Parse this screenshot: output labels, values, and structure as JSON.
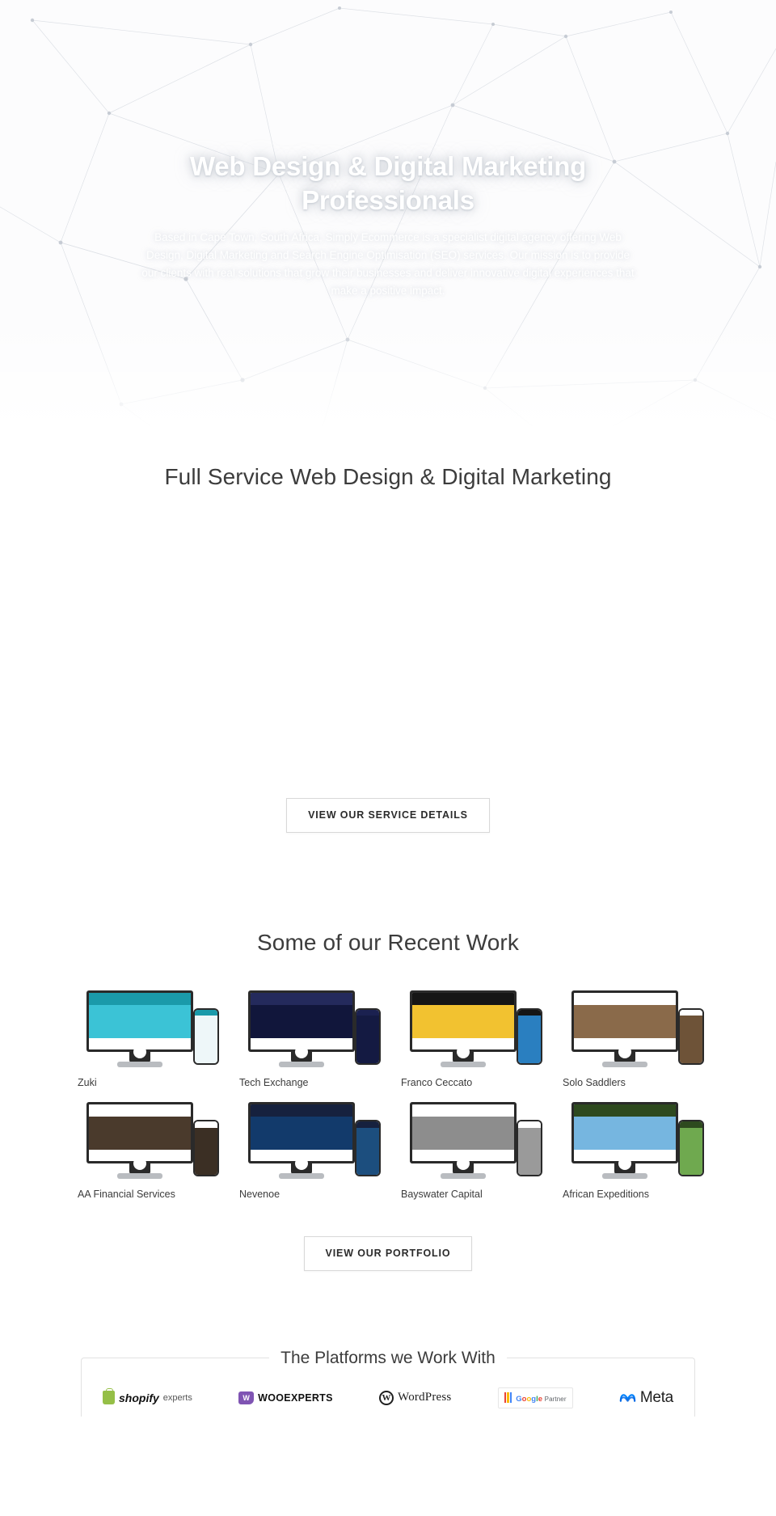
{
  "hero": {
    "title": "Web Design & Digital Marketing Professionals",
    "paragraph": "Based in Cape Town, South Africa, Simply Ecommerce is a specialist digital agency offering Web Design, Digital Marketing and Search Engine Optimisation (SEO) services. Our mission is to provide our clients with real solutions that grow their businesses and deliver innovative digital experiences that make a positive impact."
  },
  "services": {
    "title": "Full Service Web Design & Digital Marketing",
    "button_label": "VIEW OUR SERVICE DETAILS",
    "cards": [
      {
        "icon": "monitor-icon",
        "name": "",
        "desc": ""
      },
      {
        "icon": "cart-icon",
        "name": "",
        "desc": ""
      },
      {
        "icon": "chart-icon",
        "name": "",
        "desc": ""
      },
      {
        "icon": "search-icon",
        "name": "",
        "desc": ""
      },
      {
        "icon": "megaphone-icon",
        "name": "",
        "desc": ""
      },
      {
        "icon": "gear-icon",
        "name": "",
        "desc": ""
      }
    ]
  },
  "portfolio": {
    "title": "Some of our Recent Work",
    "button_label": "VIEW OUR PORTFOLIO",
    "items": [
      {
        "label": "Zuki",
        "bar": "#1a9aaa",
        "hero": "#3bc3d6",
        "accent": "#0e7d8c",
        "phone_bar": "#1a9aaa",
        "phone_hero": "#eef7f9"
      },
      {
        "label": "Tech Exchange",
        "bar": "#242a5c",
        "hero": "#11163b",
        "accent": "#2ec4b6",
        "phone_bar": "#1b2150",
        "phone_hero": "#141a42"
      },
      {
        "label": "Franco Ceccato",
        "bar": "#151515",
        "hero": "#f2c230",
        "accent": "#1d7fc4",
        "phone_bar": "#151515",
        "phone_hero": "#2a7fc0"
      },
      {
        "label": "Solo Saddlers",
        "bar": "#ffffff",
        "hero": "#8a6a4a",
        "accent": "#c0392b",
        "phone_bar": "#ffffff",
        "phone_hero": "#6e5338"
      },
      {
        "label": "AA Financial Services",
        "bar": "#ffffff",
        "hero": "#4a3a2c",
        "accent": "#e8a33d",
        "phone_bar": "#ffffff",
        "phone_hero": "#3b2f24"
      },
      {
        "label": "Nevenoe",
        "bar": "#16213e",
        "hero": "#123a6b",
        "accent": "#3ab0e0",
        "phone_bar": "#16213e",
        "phone_hero": "#1c4e7e"
      },
      {
        "label": "Bayswater Capital",
        "bar": "#ffffff",
        "hero": "#8d8d8d",
        "accent": "#20385c",
        "phone_bar": "#ffffff",
        "phone_hero": "#9a9a9a"
      },
      {
        "label": "African Expeditions",
        "bar": "#2e4a1f",
        "hero": "#76b6e0",
        "accent": "#4e7c2e",
        "phone_bar": "#2e4a1f",
        "phone_hero": "#6fa94f"
      }
    ]
  },
  "platforms": {
    "title": "The Platforms we Work With",
    "logos": [
      {
        "id": "shopify-experts-logo",
        "name": "shopify",
        "suffix": "experts"
      },
      {
        "id": "wooexperts-logo",
        "name": "WOOEXPERTS",
        "suffix": ""
      },
      {
        "id": "wordpress-logo",
        "name": "WordPress",
        "suffix": ""
      },
      {
        "id": "google-partner-logo",
        "name": "Google",
        "suffix": "Partner"
      },
      {
        "id": "meta-logo",
        "name": "Meta",
        "suffix": ""
      }
    ]
  }
}
